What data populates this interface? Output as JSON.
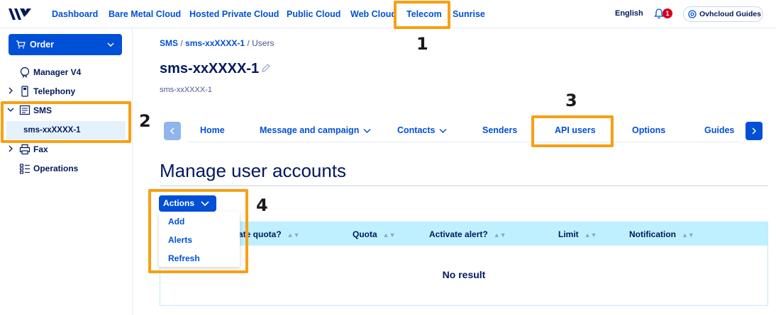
{
  "nav": {
    "items": [
      "Dashboard",
      "Bare Metal Cloud",
      "Hosted Private Cloud",
      "Public Cloud",
      "Web Cloud",
      "Telecom",
      "Sunrise"
    ],
    "language": "English",
    "notification_count": "1",
    "guides": "Ovhcloud Guides"
  },
  "sidebar": {
    "order": "Order",
    "items": [
      "Manager V4",
      "Telephony",
      "SMS",
      "Fax",
      "Operations"
    ],
    "sub_item": "sms-xxXXXX-1"
  },
  "breadcrumb": {
    "sms": "SMS",
    "sep1": "/",
    "account": "sms-xxXXXX-1",
    "sep2": "/",
    "current": "Users"
  },
  "page": {
    "title": "sms-xxXXXX-1",
    "subtitle": "sms-xxXXXX-1"
  },
  "tabs": [
    "Home",
    "Message and campaign",
    "Contacts",
    "Senders",
    "API users",
    "Options",
    "Guides"
  ],
  "section": {
    "title": "Manage user accounts"
  },
  "actions": {
    "label": "Actions",
    "menu": [
      "Add",
      "Alerts",
      "Refresh"
    ]
  },
  "table": {
    "headers": [
      "ate quota?",
      "Quota",
      "Activate alert?",
      "Limit",
      "Notification"
    ],
    "empty": "No result"
  },
  "annotations": [
    "1",
    "2",
    "3",
    "4"
  ],
  "colors": {
    "primary": "#0050d7",
    "text": "#00185e",
    "highlight": "#f7a014",
    "table_header": "#bff0ff"
  }
}
